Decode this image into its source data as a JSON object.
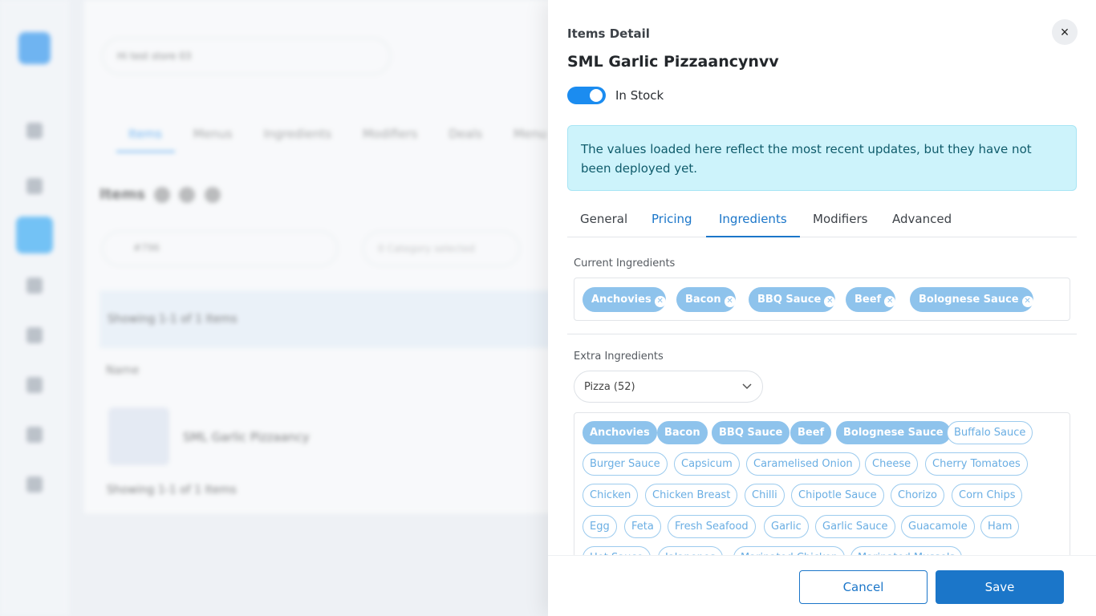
{
  "background": {
    "store_select": "Hi test store 03",
    "tabs": [
      "Items",
      "Menus",
      "Ingredients",
      "Modifiers",
      "Deals",
      "Menu Sett"
    ],
    "items_title": "Items",
    "search_value": "#796",
    "category_placeholder": "0 Category selected",
    "showing_text": "Showing 1-1 of 1 Items",
    "name_column": "Name",
    "row_name": "SML Garlic Pizzaancy",
    "footer_text": "Showing 1-1 of 1 Items"
  },
  "drawer": {
    "header": "Items Detail",
    "item_name": "SML Garlic Pizzaancynvv",
    "stock_label": "In Stock",
    "stock_on": true,
    "close_icon": "×",
    "alert": "The values loaded here reflect the most recent updates, but they have not been deployed yet.",
    "tabs": [
      {
        "label": "General"
      },
      {
        "label": "Pricing"
      },
      {
        "label": "Ingredients"
      },
      {
        "label": "Modifiers"
      },
      {
        "label": "Advanced"
      }
    ],
    "active_tab": "Ingredients",
    "current_label": "Current Ingredients",
    "current_ingredients": [
      "Anchovies",
      "Bacon",
      "BBQ Sauce",
      "Beef",
      "Bolognese Sauce"
    ],
    "remove_icon": "✕",
    "extra_label": "Extra Ingredients",
    "category_select": "Pizza (52)",
    "extra_ingredients": {
      "row1": [
        "Anchovies",
        "Bacon",
        "BBQ Sauce",
        "Beef",
        "Bolognese Sauce",
        "Buffalo Sauce"
      ],
      "row2": [
        "Burger Sauce",
        "Capsicum",
        "Caramelised Onion",
        "Cheese",
        "Cherry Tomatoes"
      ],
      "row3": [
        "Chicken",
        "Chicken Breast",
        "Chilli",
        "Chipotle Sauce",
        "Chorizo",
        "Corn Chips"
      ],
      "row4": [
        "Egg",
        "Feta",
        "Fresh Seafood",
        "Garlic",
        "Garlic Sauce",
        "Guacamole",
        "Ham"
      ],
      "row5": [
        "Hot Sauce",
        "Jalapenos",
        "Marinated Chicken",
        "Marinated Mussels"
      ]
    },
    "cancel_label": "Cancel",
    "save_label": "Save"
  },
  "colors": {
    "accent": "#1b76c9",
    "toggle": "#1b8cf0",
    "chip": "#8ec3ec",
    "alert_bg": "#cdf3fb",
    "alert_text": "#0f5b6b"
  }
}
